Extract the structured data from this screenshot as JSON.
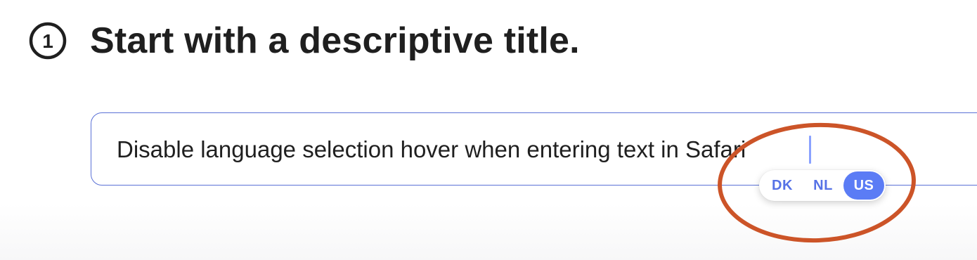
{
  "header": {
    "step_number": "1",
    "title": "Start with a descriptive title."
  },
  "title_input": {
    "value": "Disable language selection hover when entering text in Safari"
  },
  "language_popover": {
    "options": [
      {
        "label": "DK",
        "selected": false
      },
      {
        "label": "NL",
        "selected": false
      },
      {
        "label": "US",
        "selected": true
      }
    ]
  },
  "colors": {
    "input_border": "#5b72d6",
    "accent": "#5b7cf5",
    "option_text": "#5672e6",
    "annotation": "#cc5428"
  }
}
